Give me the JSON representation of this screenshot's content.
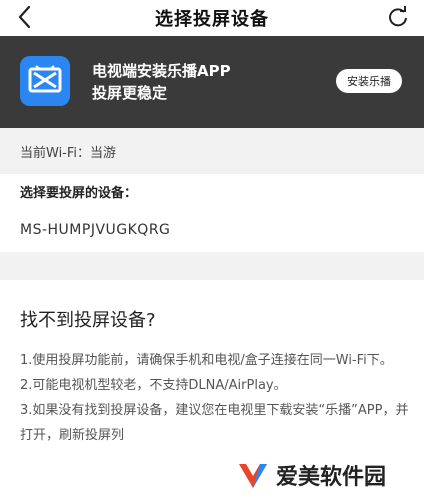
{
  "header": {
    "title": "选择投屏设备",
    "back_icon": "chevron-left-icon",
    "refresh_icon": "refresh-icon"
  },
  "banner": {
    "line1": "电视端安装乐播APP",
    "line2": "投屏更稳定",
    "install_label": "安装乐播",
    "icon_color": "#2a86f0",
    "background": "#3a3a3a"
  },
  "wifi": {
    "label": "当前Wi-Fi：当游"
  },
  "device_section": {
    "title": "选择要投屏的设备：",
    "devices": [
      "MS-HUMPJVUGKQRG"
    ]
  },
  "help": {
    "title": "找不到投屏设备?",
    "items": [
      "1.使用投屏功能前，请确保手机和电视/盒子连接在同一Wi-Fi下。",
      "2.可能电视机型较老，不支持DLNA/AirPlay。",
      "3.如果没有找到投屏设备，建议您在电视里下载安装“乐播”APP，并打开，刷新投屏列"
    ]
  },
  "watermark": {
    "text": "爱美软件园"
  }
}
